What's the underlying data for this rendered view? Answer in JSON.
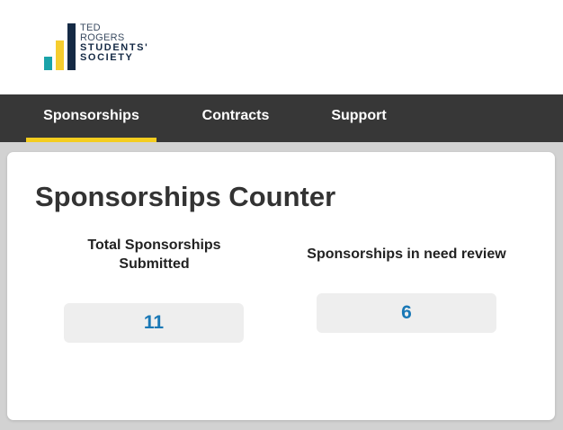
{
  "logo": {
    "line1": "TED",
    "line2": "ROGERS",
    "line3": "STUDENTS'",
    "line4": "SOCIETY",
    "colors": {
      "teal": "#1aa3a9",
      "yellow": "#f6cd2e",
      "navy": "#152a45"
    }
  },
  "nav": {
    "items": [
      {
        "label": "Sponsorships",
        "active": true
      },
      {
        "label": "Contracts",
        "active": false
      },
      {
        "label": "Support",
        "active": false
      }
    ],
    "background": "#373737",
    "active_underline": "#f4cd1f"
  },
  "main": {
    "title": "Sponsorships Counter",
    "stats": [
      {
        "label": "Total Sponsorships Submitted",
        "value": "11"
      },
      {
        "label": "Sponsorships in need review",
        "value": "6"
      }
    ],
    "value_color": "#1978b6"
  }
}
